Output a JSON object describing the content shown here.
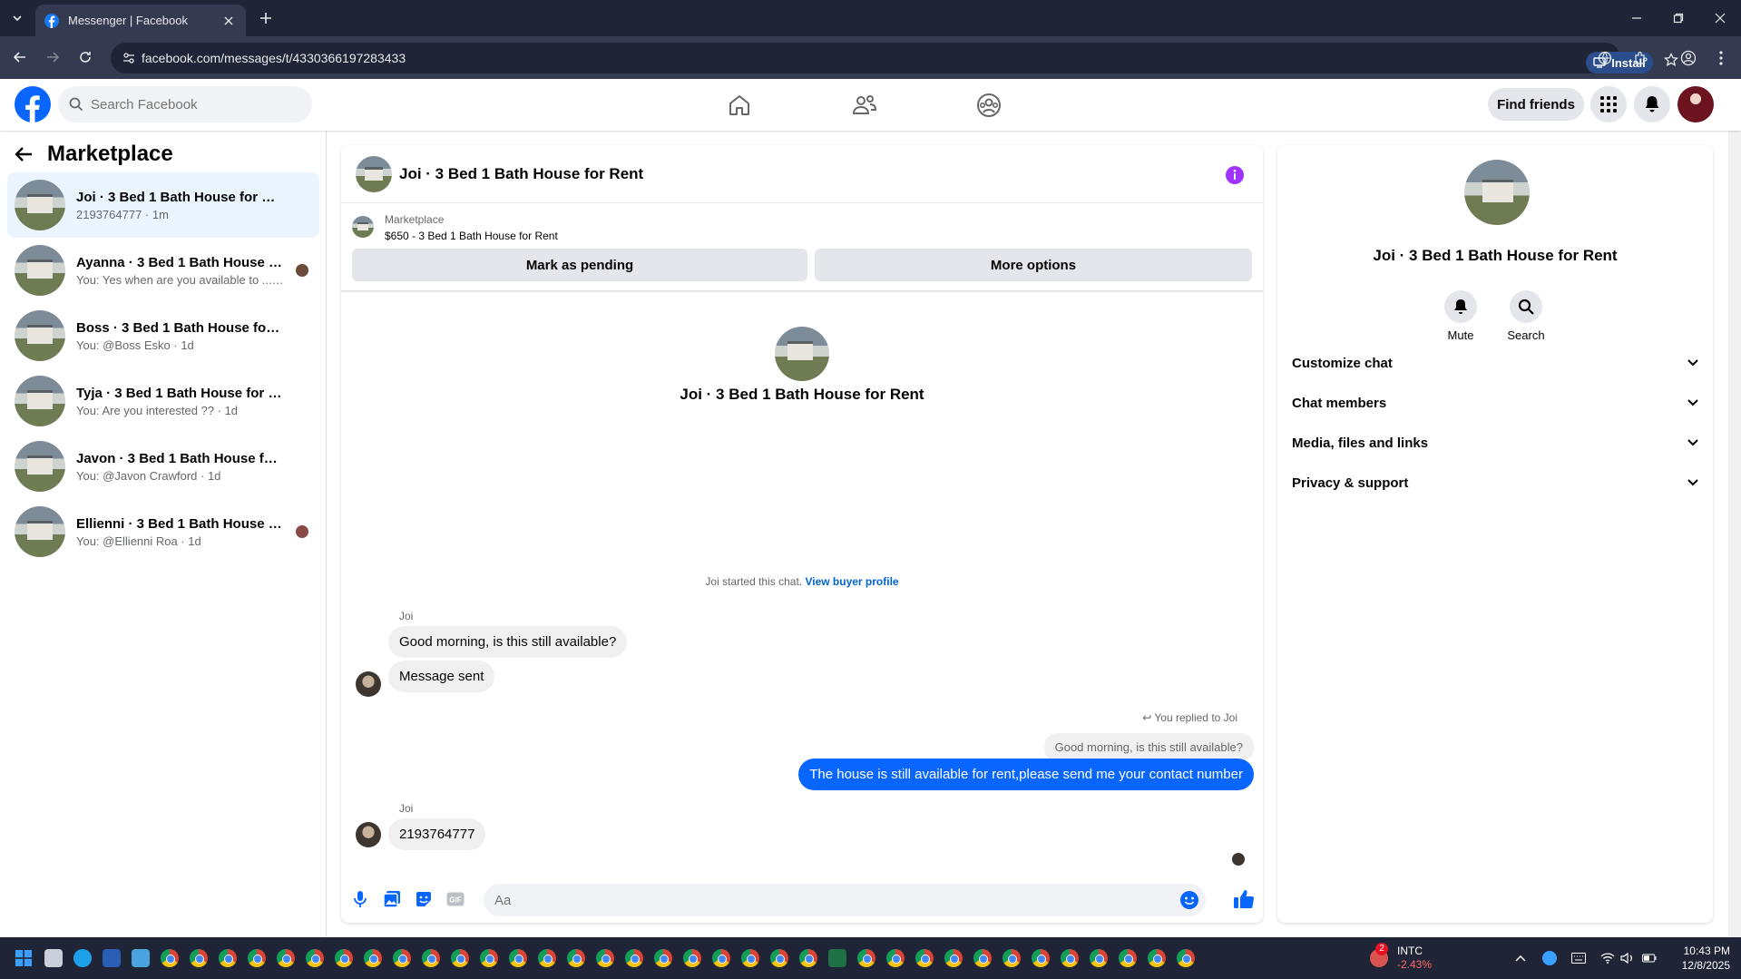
{
  "browser": {
    "tab_title": "Messenger | Facebook",
    "url": "facebook.com/messages/t/4330366197283433",
    "install_label": "Install"
  },
  "fb_header": {
    "search_placeholder": "Search Facebook",
    "find_friends": "Find friends"
  },
  "sidebar": {
    "title": "Marketplace",
    "conversations": [
      {
        "name": "Joi · 3 Bed 1 Bath House for Rent",
        "preview": "2193764777 · 1m",
        "active": true
      },
      {
        "name": "Ayanna · 3 Bed 1 Bath House for...",
        "preview": "You: Yes when are you available to ... · 1d"
      },
      {
        "name": "Boss · 3 Bed 1 Bath House for Rent",
        "preview": "You: @Boss Esko · 1d"
      },
      {
        "name": "Tyja · 3 Bed 1 Bath House for Rent",
        "preview": "You: Are you interested ?? · 1d"
      },
      {
        "name": "Javon · 3 Bed 1 Bath House for Rent",
        "preview": "You: @Javon Crawford · 1d"
      },
      {
        "name": "Ellienni · 3 Bed 1 Bath House for...",
        "preview": "You: @Ellienni Roa · 1d"
      }
    ]
  },
  "chat": {
    "title": "Joi · 3 Bed 1 Bath House for Rent",
    "marketplace_label": "Marketplace",
    "listing": "$650 - 3 Bed 1 Bath House for Rent",
    "mark_pending": "Mark as pending",
    "more_options": "More options",
    "intro_title": "Joi · 3 Bed 1 Bath House for Rent",
    "started_text": "Joi started this chat.",
    "view_profile": "View buyer profile",
    "sender1": "Joi",
    "msg1": "Good morning, is this still available?",
    "msg2": "Message sent",
    "replied_label": "You replied to Joi",
    "quoted": "Good morning, is this still available?",
    "my_reply": "The house is still available for rent,please send me your contact number",
    "sender2": "Joi",
    "msg3": "2193764777",
    "composer_placeholder": "Aa"
  },
  "details": {
    "title": "Joi · 3 Bed 1 Bath House for Rent",
    "mute": "Mute",
    "search": "Search",
    "sections": [
      "Customize chat",
      "Chat members",
      "Media, files and links",
      "Privacy & support"
    ]
  },
  "taskbar": {
    "stock_symbol": "INTC",
    "stock_change": "-2.43%",
    "badge": "2",
    "time": "10:43 PM",
    "date": "12/8/2025"
  },
  "colors": {
    "fb_blue": "#1877f2",
    "messenger_blue": "#0866ff",
    "info_purple": "#a033ff"
  }
}
